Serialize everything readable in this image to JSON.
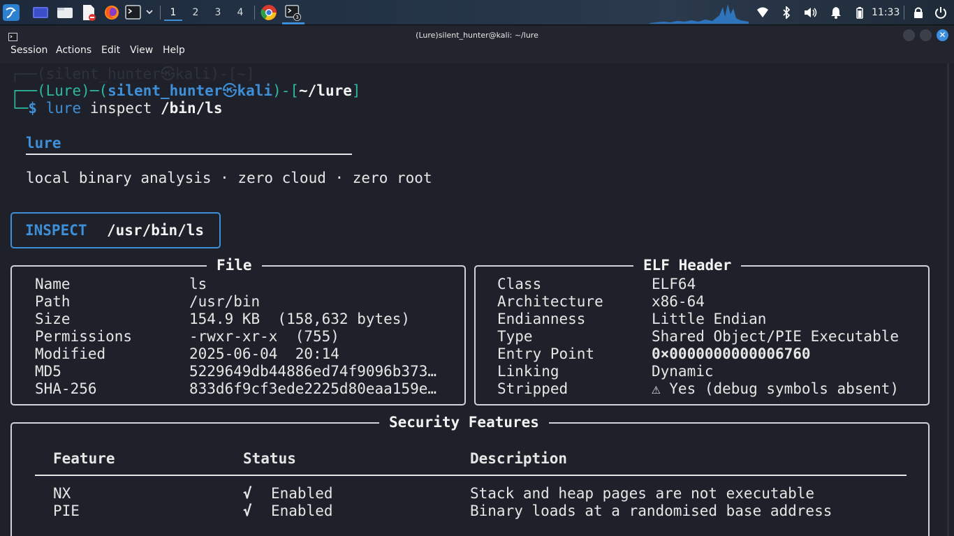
{
  "panel": {
    "workspaces": [
      "1",
      "2",
      "3",
      "4"
    ],
    "active_workspace": "1",
    "clock": "11:33",
    "terminal_badge": "3",
    "icons": [
      "kali-menu-icon",
      "desktop-icon",
      "file-manager-icon",
      "text-editor-icon",
      "firefox-icon",
      "terminal-icon",
      "chromium-icon",
      "terminal-window-icon",
      "network-icon",
      "bluetooth-icon",
      "volume-icon",
      "notifications-icon",
      "battery-icon",
      "lock-icon",
      "power-icon"
    ]
  },
  "window": {
    "title": "(Lure)silent_hunter@kali: ~/lure",
    "menu": [
      "Session",
      "Actions",
      "Edit",
      "View",
      "Help"
    ],
    "close_glyph": "✕"
  },
  "terminal": {
    "ghost_line": "┌──(silent_hunter㉿kali)-[~]",
    "prompt": {
      "corner_top": "┌──",
      "venv": "(Lure)",
      "dash": "─",
      "user_host_open": "(",
      "user": "silent_hunter",
      "at": "㉿",
      "host": "kali",
      "user_host_close": ")",
      "dir_sep": "-[",
      "dir": "~/lure",
      "dir_close": "]",
      "corner_bottom": "└─",
      "dollar": "$",
      "cmd_word": "lure",
      "cmd_arg1": "inspect",
      "cmd_path": "/bin/ls"
    },
    "banner": {
      "name": "lure",
      "rule": "────────────────────────────────────",
      "tagline": "local binary analysis · zero cloud · zero root"
    },
    "inspect": {
      "label": "INSPECT",
      "path": "/usr/bin/ls"
    },
    "file_panel": {
      "title": "File",
      "rows": [
        {
          "key": "Name",
          "value": "ls"
        },
        {
          "key": "Path",
          "value": "/usr/bin"
        },
        {
          "key": "Size",
          "value": "154.9 KB  (158,632 bytes)"
        },
        {
          "key": "Permissions",
          "value": "-rwxr-xr-x  (755)"
        },
        {
          "key": "Modified",
          "value": "2025-06-04  20:14"
        },
        {
          "key": "MD5",
          "value": "5229649db44886ed74f9096b373…"
        },
        {
          "key": "SHA-256",
          "value": "833d6f9cf3ede2225d80eaa159e…"
        }
      ]
    },
    "elf_panel": {
      "title": "ELF Header",
      "rows": [
        {
          "key": "Class",
          "value": "ELF64"
        },
        {
          "key": "Architecture",
          "value": "x86-64"
        },
        {
          "key": "Endianness",
          "value": "Little Endian"
        },
        {
          "key": "Type",
          "value": "Shared Object/PIE Executable"
        },
        {
          "key": "Entry Point",
          "value": "0×0000000000006760"
        },
        {
          "key": "Linking",
          "value": "Dynamic"
        },
        {
          "key": "Stripped",
          "value": "⚠ Yes (debug symbols absent)"
        }
      ]
    },
    "security_panel": {
      "title": "Security Features",
      "headers": [
        "Feature",
        "Status",
        "Description"
      ],
      "rows": [
        {
          "feature": "NX",
          "check": "√",
          "status": "Enabled",
          "description": "Stack and heap pages are not executable"
        },
        {
          "feature": "PIE",
          "check": "√",
          "status": "Enabled",
          "description": "Binary loads at a randomised base address"
        }
      ]
    },
    "colors": {
      "accent_blue": "#3f8fd8",
      "prompt_green": "#2fb7a0",
      "teal": "#3fd0b2",
      "warning_orange": "#e8a43c",
      "background": "#1e2129"
    }
  }
}
